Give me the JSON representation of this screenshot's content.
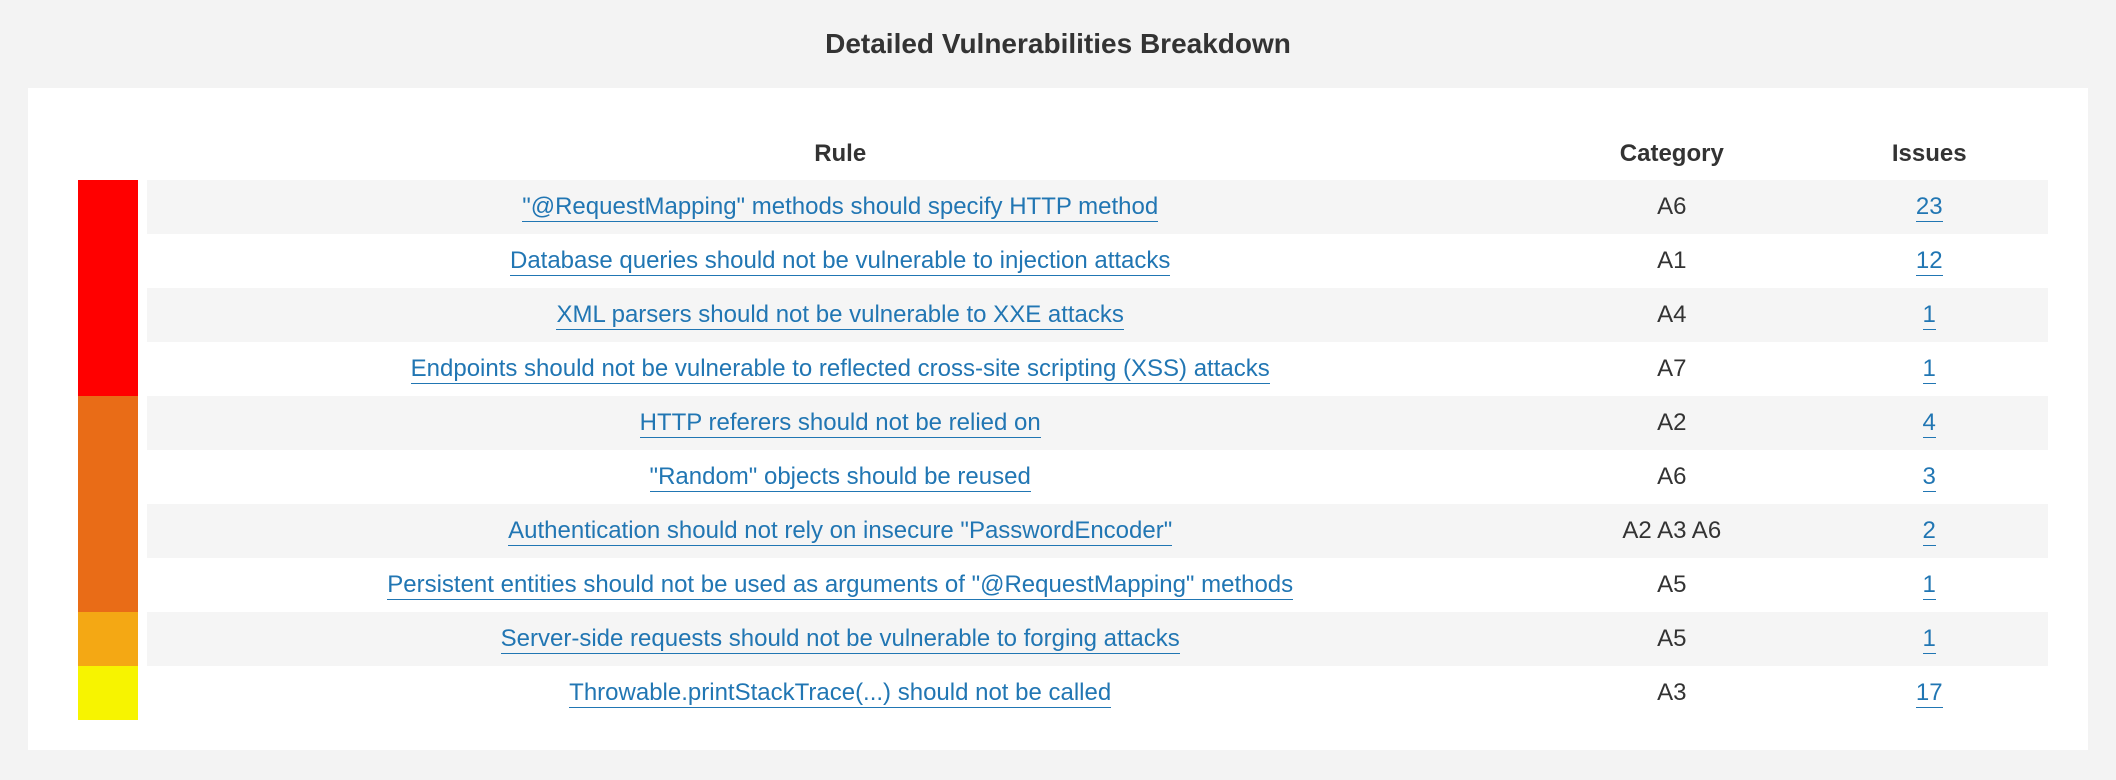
{
  "title": "Detailed Vulnerabilities Breakdown",
  "columns": {
    "rule": "Rule",
    "category": "Category",
    "issues": "Issues"
  },
  "severityColors": {
    "blocker": "#ff0000",
    "critical": "#e96c17",
    "major": "#f4a814",
    "minor": "#f7f400"
  },
  "rows": [
    {
      "severity": "blocker",
      "rule": "\"@RequestMapping\" methods should specify HTTP method",
      "category": "A6",
      "issues": 23
    },
    {
      "severity": "blocker",
      "rule": "Database queries should not be vulnerable to injection attacks",
      "category": "A1",
      "issues": 12
    },
    {
      "severity": "blocker",
      "rule": "XML parsers should not be vulnerable to XXE attacks",
      "category": "A4",
      "issues": 1
    },
    {
      "severity": "blocker",
      "rule": "Endpoints should not be vulnerable to reflected cross-site scripting (XSS) attacks",
      "category": "A7",
      "issues": 1
    },
    {
      "severity": "critical",
      "rule": "HTTP referers should not be relied on",
      "category": "A2",
      "issues": 4
    },
    {
      "severity": "critical",
      "rule": "\"Random\" objects should be reused",
      "category": "A6",
      "issues": 3
    },
    {
      "severity": "critical",
      "rule": "Authentication should not rely on insecure \"PasswordEncoder\"",
      "category": "A2 A3 A6",
      "issues": 2
    },
    {
      "severity": "critical",
      "rule": "Persistent entities should not be used as arguments of \"@RequestMapping\" methods",
      "category": "A5",
      "issues": 1
    },
    {
      "severity": "major",
      "rule": "Server-side requests should not be vulnerable to forging attacks",
      "category": "A5",
      "issues": 1
    },
    {
      "severity": "minor",
      "rule": "Throwable.printStackTrace(...) should not be called",
      "category": "A3",
      "issues": 17
    }
  ]
}
